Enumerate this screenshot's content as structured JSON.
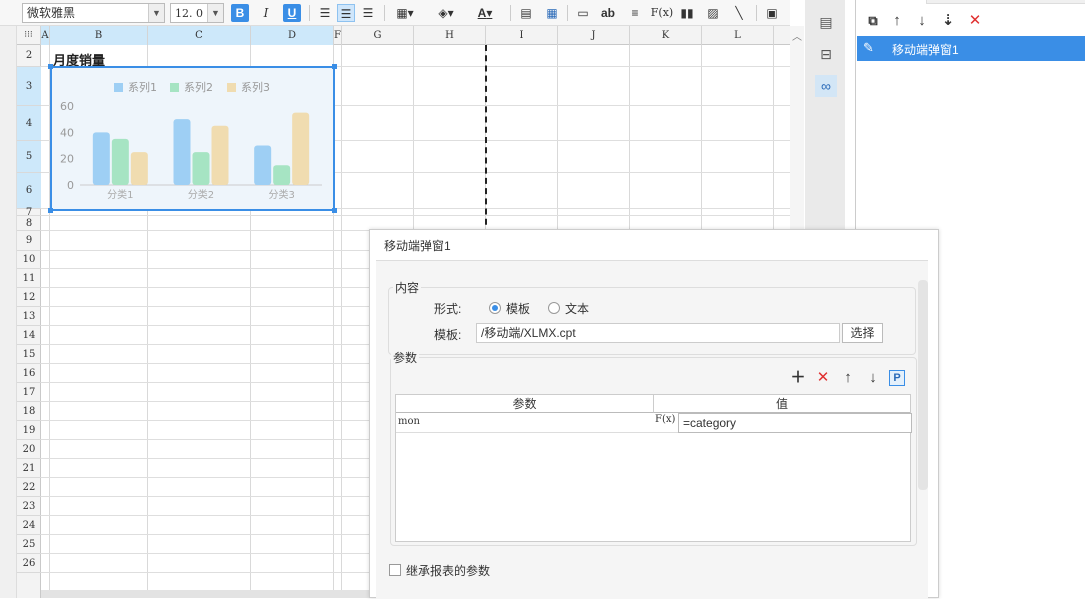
{
  "toolbar": {
    "font_name": "微软雅黑",
    "font_size": "12. 0",
    "bold": "B",
    "italic": "I",
    "underline": "U",
    "text_color_glyph": "A",
    "abc_glyph": "ab",
    "fx_glyph": "F(x)"
  },
  "grid": {
    "columns": [
      "A",
      "B",
      "C",
      "D",
      "F",
      "G",
      "H",
      "I",
      "J",
      "K",
      "L"
    ],
    "rows": [
      "2",
      "3",
      "4",
      "5",
      "6",
      "7",
      "8",
      "9",
      "10",
      "11",
      "12",
      "13",
      "14",
      "15",
      "16",
      "17",
      "18",
      "19",
      "20",
      "21",
      "22",
      "23",
      "24",
      "25",
      "26"
    ],
    "title_cell": "月度销量"
  },
  "chart_data": {
    "type": "bar",
    "categories": [
      "分类1",
      "分类2",
      "分类3"
    ],
    "series": [
      {
        "name": "系列1",
        "values": [
          40,
          50,
          30
        ],
        "color": "#9ecff4"
      },
      {
        "name": "系列2",
        "values": [
          35,
          25,
          15
        ],
        "color": "#a6e4c3"
      },
      {
        "name": "系列3",
        "values": [
          25,
          45,
          55
        ],
        "color": "#f0dcb0"
      }
    ],
    "yticks": [
      "60",
      "40",
      "20",
      "0"
    ],
    "ylim": [
      0,
      60
    ],
    "legend_position": "top",
    "grid": false
  },
  "right_panel": {
    "item_label": "移动端弹窗1"
  },
  "dialog": {
    "title": "移动端弹窗1",
    "content_legend": "内容",
    "form_label": "形式:",
    "option_template": "模板",
    "option_text": "文本",
    "template_label": "模板:",
    "template_value": "/移动端/XLMX.cpt",
    "choose_button": "选择",
    "params_legend": "参数",
    "param_header": "参数",
    "value_header": "值",
    "param_rows": [
      {
        "name": "mon",
        "value": "=category"
      }
    ],
    "inherit_label": "继承报表的参数",
    "fx_glyph": "F(x)",
    "p_glyph": "P"
  },
  "colors": {
    "accent": "#3a8ee6",
    "delete": "#e03030"
  }
}
